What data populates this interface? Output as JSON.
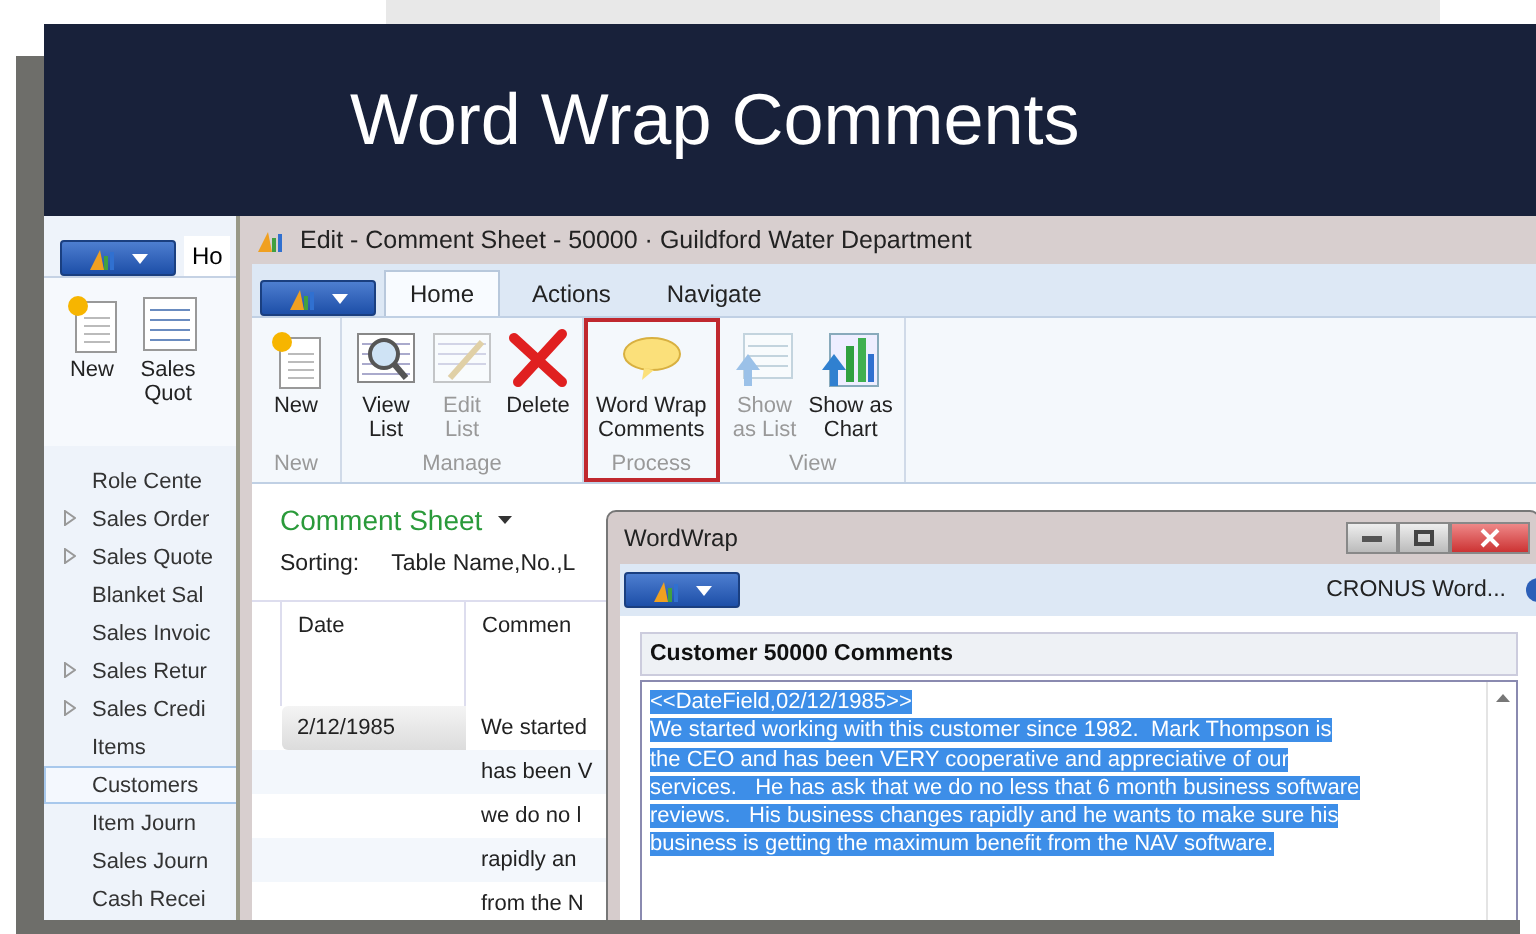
{
  "slide": {
    "title": "Word Wrap Comments"
  },
  "back_window": {
    "tab": "Ho",
    "actions": [
      {
        "kind": "new",
        "label": "New"
      },
      {
        "kind": "quote",
        "label": "Sales\nQuot"
      }
    ],
    "nav_items": [
      {
        "label": "Role Cente",
        "expandable": false,
        "selected": false
      },
      {
        "label": "Sales Order",
        "expandable": true,
        "selected": false
      },
      {
        "label": "Sales Quote",
        "expandable": true,
        "selected": false
      },
      {
        "label": "Blanket Sal",
        "expandable": false,
        "selected": false
      },
      {
        "label": "Sales Invoic",
        "expandable": false,
        "selected": false
      },
      {
        "label": "Sales Retur",
        "expandable": true,
        "selected": false
      },
      {
        "label": "Sales Credi",
        "expandable": true,
        "selected": false
      },
      {
        "label": "Items",
        "expandable": false,
        "selected": false
      },
      {
        "label": "Customers",
        "expandable": false,
        "selected": true
      },
      {
        "label": "Item Journ",
        "expandable": false,
        "selected": false
      },
      {
        "label": "Sales Journ",
        "expandable": false,
        "selected": false
      },
      {
        "label": "Cash Recei",
        "expandable": false,
        "selected": false
      }
    ]
  },
  "edit_window": {
    "title": "Edit - Comment Sheet - 50000 · Guildford Water Department",
    "tabs": [
      {
        "label": "Home",
        "selected": true
      },
      {
        "label": "Actions",
        "selected": false
      },
      {
        "label": "Navigate",
        "selected": false
      }
    ],
    "groups": [
      {
        "label": "New",
        "highlighted": false,
        "actions": [
          {
            "kind": "new",
            "label": "New",
            "disabled": false
          }
        ]
      },
      {
        "label": "Manage",
        "highlighted": false,
        "actions": [
          {
            "kind": "view-list",
            "label": "View\nList",
            "disabled": false
          },
          {
            "kind": "edit-list",
            "label": "Edit\nList",
            "disabled": true
          },
          {
            "kind": "delete",
            "label": "Delete",
            "disabled": false
          }
        ]
      },
      {
        "label": "Process",
        "highlighted": true,
        "actions": [
          {
            "kind": "comment",
            "label": "Word Wrap\nComments",
            "disabled": false
          }
        ]
      },
      {
        "label": "View",
        "highlighted": false,
        "actions": [
          {
            "kind": "show-list",
            "label": "Show\nas List",
            "disabled": true
          },
          {
            "kind": "show-chart",
            "label": "Show as\nChart",
            "disabled": false
          }
        ]
      }
    ],
    "page_title": "Comment Sheet",
    "sorting_label": "Sorting:",
    "sorting_value": "Table Name,No.,L",
    "columns": [
      "Date",
      "Commen"
    ],
    "rows": [
      {
        "date": "2/12/1985",
        "comment": "We started",
        "selected": true
      },
      {
        "date": "",
        "comment": "has been V",
        "selected": false
      },
      {
        "date": "",
        "comment": "we do no l",
        "selected": false
      },
      {
        "date": "",
        "comment": "rapidly an",
        "selected": false
      },
      {
        "date": "",
        "comment": "from the N",
        "selected": false
      }
    ]
  },
  "dialog": {
    "title": "WordWrap",
    "company": "CRONUS Word...",
    "section_title": "Customer 50000 Comments",
    "comment": {
      "selected": true,
      "lines": [
        "<<DateField,02/12/1985>>",
        "We started working with this customer since 1982.  Mark Thompson is",
        "the CEO and has been VERY cooperative and appreciative of our",
        "services.   He has ask that we do no less that 6 month business software",
        "reviews.   His business changes rapidly and he wants to make sure his",
        "business is getting the maximum benefit from the NAV software."
      ]
    }
  }
}
